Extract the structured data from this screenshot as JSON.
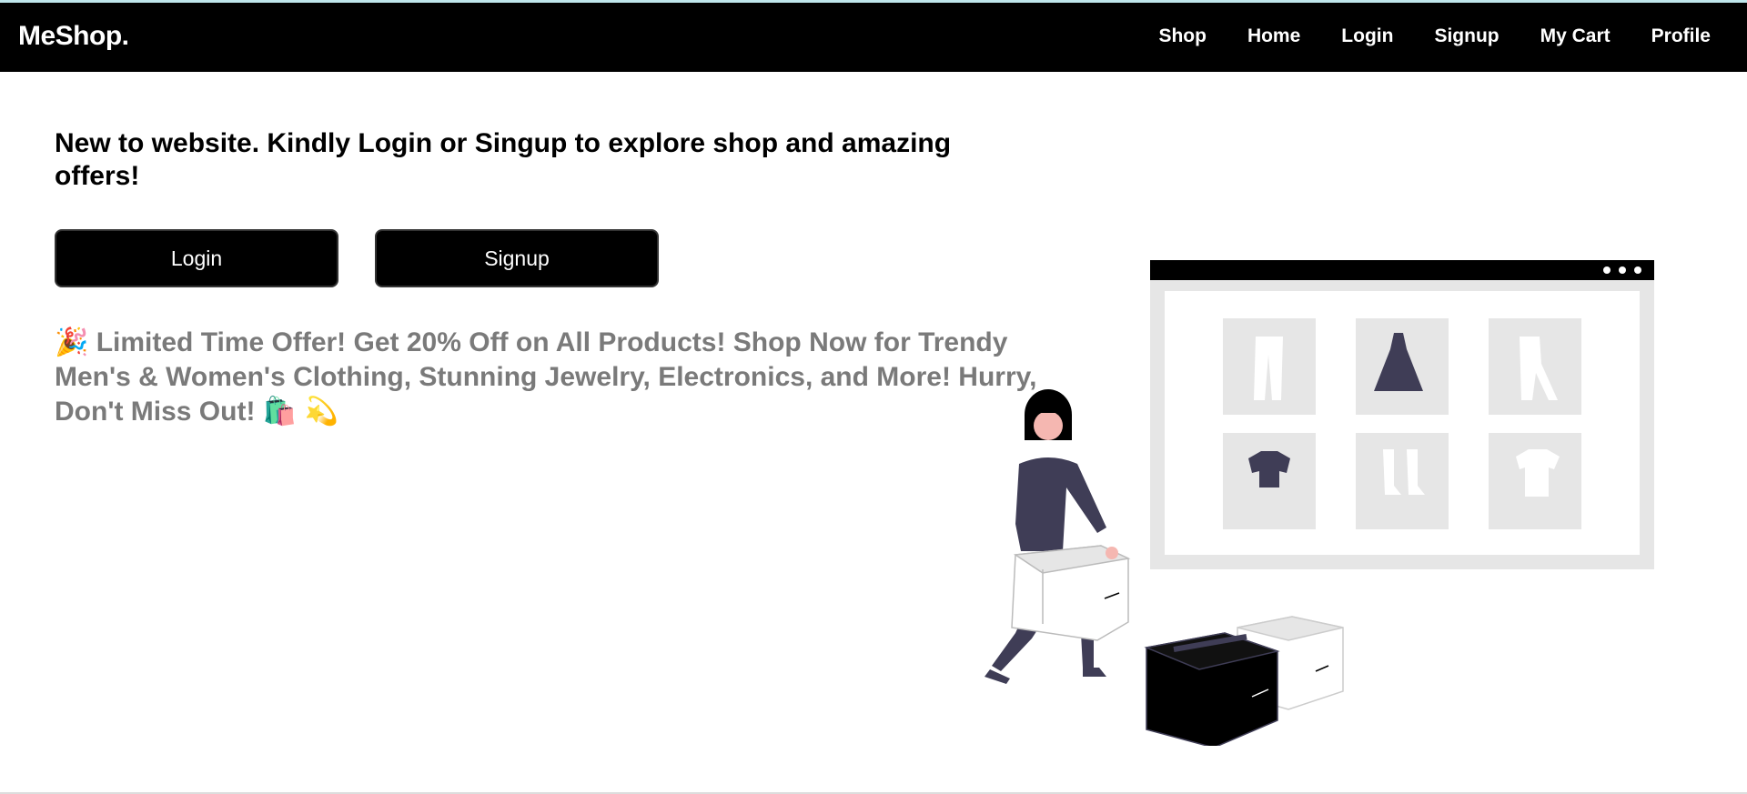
{
  "nav": {
    "brand": "MeShop.",
    "links": [
      "Shop",
      "Home",
      "Login",
      "Signup",
      "My Cart",
      "Profile"
    ]
  },
  "hero": {
    "intro": "New to website. Kindly Login or Singup to explore shop and amazing offers!",
    "login_label": "Login",
    "signup_label": "Signup",
    "offer_text": "🎉 Limited Time Offer! Get 20% Off on All Products! Shop Now for Trendy Men's & Women's Clothing, Stunning Jewelry, Electronics, and More! Hurry, Don't Miss Out! 🛍️ 💫"
  },
  "colors": {
    "navbar_bg": "#000000",
    "accent_dark": "#3f3d56",
    "illustration_gray": "#e6e6e6"
  },
  "icons": {
    "illustration": "shopping-woman-carrying-boxes-illustration"
  }
}
